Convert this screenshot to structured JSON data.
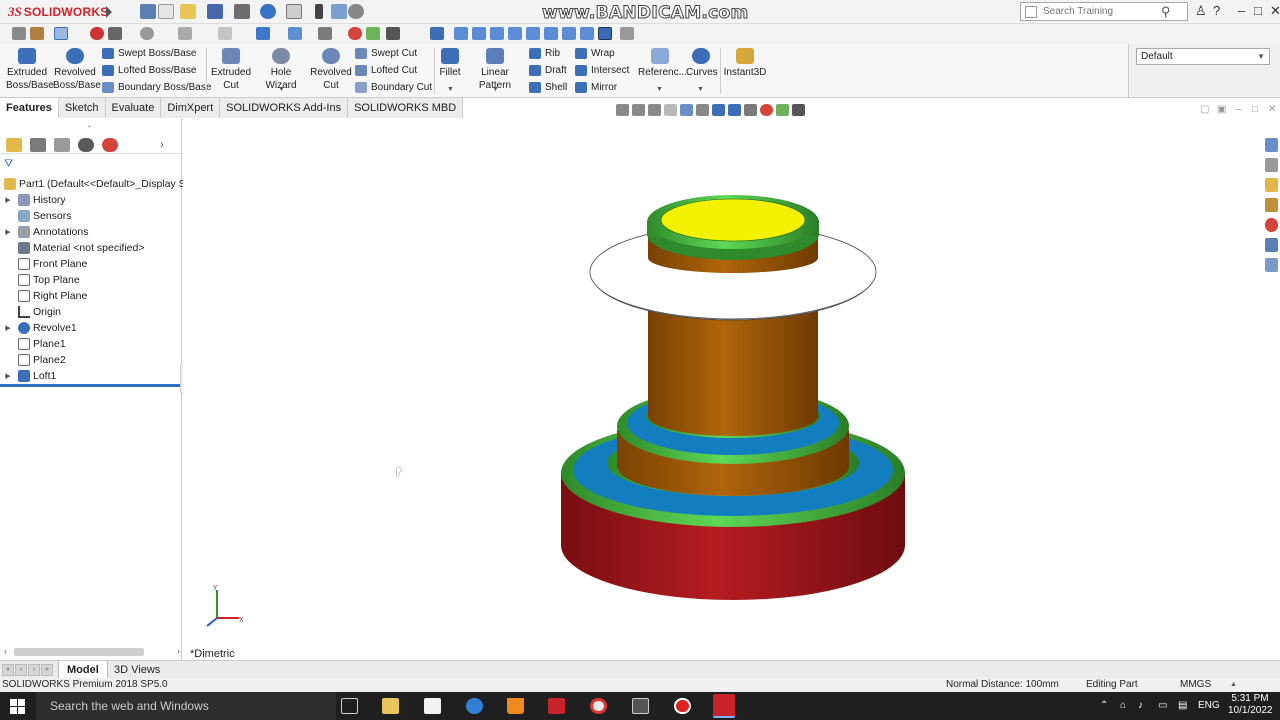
{
  "app": {
    "logo_ds": "3S",
    "logo_name": "SOLIDWORKS",
    "watermark": "www.BANDICAM.com"
  },
  "search": {
    "placeholder": "Search Training"
  },
  "window_controls": [
    "?",
    "–",
    "□",
    "✕"
  ],
  "command_manager": {
    "extruded_boss": [
      "Extruded",
      "Boss/Base"
    ],
    "revolved_boss": [
      "Revolved",
      "Boss/Base"
    ],
    "swept_boss": "Swept Boss/Base",
    "lofted_boss": "Lofted Boss/Base",
    "boundary_boss": "Boundary Boss/Base",
    "extruded_cut": [
      "Extruded",
      "Cut"
    ],
    "hole_wizard": "Hole Wizard",
    "revolved_cut": [
      "Revolved",
      "Cut"
    ],
    "swept_cut": "Swept Cut",
    "lofted_cut": "Lofted Cut",
    "boundary_cut": "Boundary Cut",
    "fillet": "Fillet",
    "linear_pattern": "Linear Pattern",
    "rib": "Rib",
    "draft": "Draft",
    "shell": "Shell",
    "wrap": "Wrap",
    "intersect": "Intersect",
    "mirror": "Mirror",
    "reference": "Referenc...",
    "curves": "Curves",
    "instant3d": "Instant3D"
  },
  "configuration": {
    "selected": "Default"
  },
  "tabs": [
    "Features",
    "Sketch",
    "Evaluate",
    "DimXpert",
    "SOLIDWORKS Add-Ins",
    "SOLIDWORKS MBD"
  ],
  "tree": {
    "root": "Part1  (Default<<Default>_Display S",
    "items": [
      {
        "label": "History",
        "expandable": true
      },
      {
        "label": "Sensors",
        "expandable": false
      },
      {
        "label": "Annotations",
        "expandable": true
      },
      {
        "label": "Material <not specified>",
        "expandable": false
      },
      {
        "label": "Front Plane",
        "expandable": false
      },
      {
        "label": "Top Plane",
        "expandable": false
      },
      {
        "label": "Right Plane",
        "expandable": false
      },
      {
        "label": "Origin",
        "expandable": false
      },
      {
        "label": "Revolve1",
        "expandable": true
      },
      {
        "label": "Plane1",
        "expandable": false
      },
      {
        "label": "Plane2",
        "expandable": false
      },
      {
        "label": "Loft1",
        "expandable": true
      }
    ]
  },
  "viewport": {
    "view_name": "*Dimetric",
    "triad_y": "Y",
    "triad_x": "X"
  },
  "model_tabs": {
    "model": "Model",
    "views3d": "3D Views"
  },
  "status": {
    "version": "SOLIDWORKS Premium 2018 SP5.0",
    "normal_distance": "Normal Distance: 100mm",
    "mode": "Editing Part",
    "units": "MMGS"
  },
  "taskbar": {
    "search": "Search the web and Windows",
    "lang": "ENG",
    "time": "5:31 PM",
    "date": "10/1/2022"
  },
  "colors": {
    "base_red": "#a3161a",
    "green_ring": "#4fc048",
    "blue_ring": "#127ec0",
    "orange": "#a05a06",
    "yellow_top": "#f2f200",
    "white_disc": "#ffffff"
  }
}
